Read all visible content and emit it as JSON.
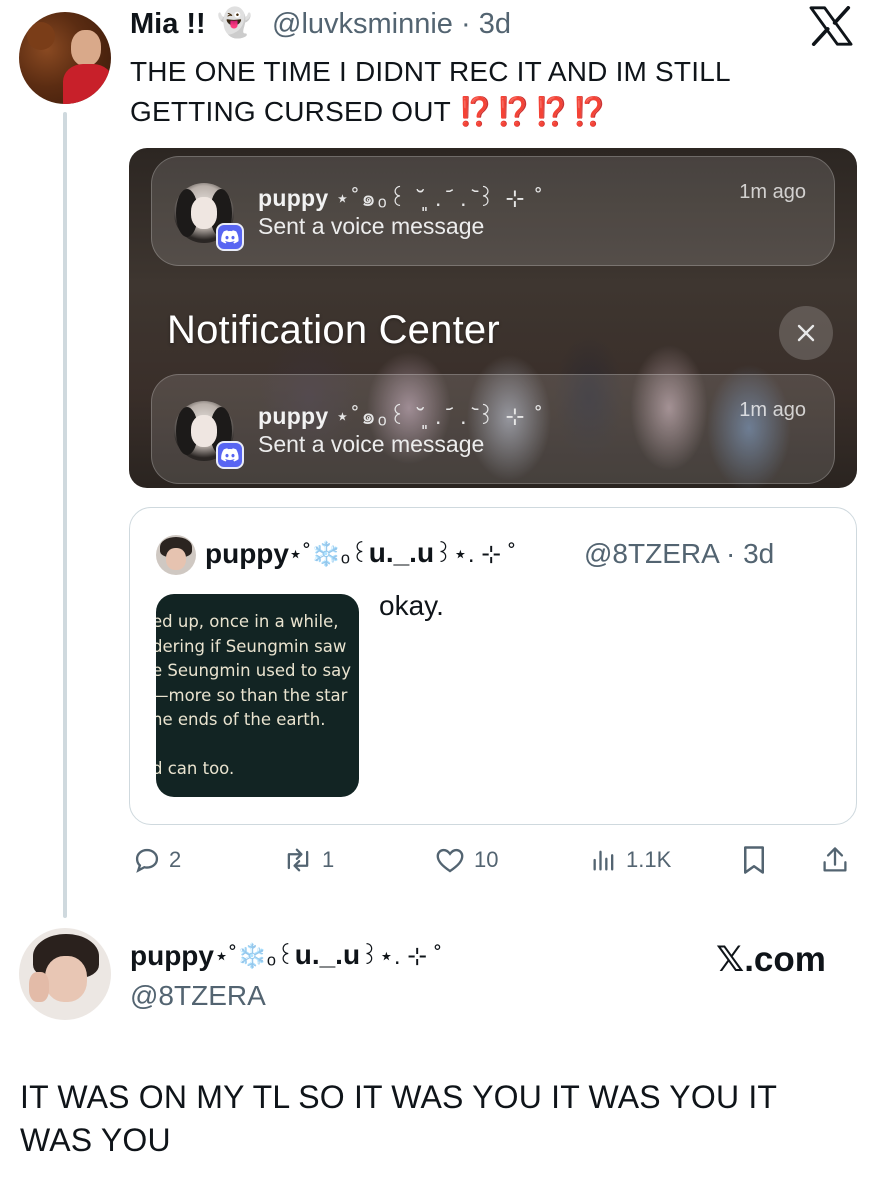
{
  "author": {
    "name": "Mia !!",
    "emoji": "👻",
    "handle_time": "@luvksminnie · 3d"
  },
  "tweet": {
    "text": "THE ONE TIME I DIDNT REC IT AND IM STILL GETTING CURSED OUT",
    "emphasis": "⁉️⁉️⁉️⁉️"
  },
  "notification_image": {
    "header": "Notification Center",
    "cards": [
      {
        "title": "puppy",
        "title_deco": "⋆˚๑ₒ꒰ ˘͈ . ᷄ . ᷅꒱ ⊹ ˚",
        "subtitle": "Sent a voice message",
        "time": "1m ago"
      },
      {
        "title": "puppy",
        "title_deco": "⋆˚๑ₒ꒰ ˘͈ . ᷄ . ᷅꒱ ⊹ ˚",
        "subtitle": "Sent a voice message",
        "time": "1m ago"
      }
    ]
  },
  "quote": {
    "name": "puppy",
    "name_deco": "⋆˚❄️ₒ꒰",
    "name_mid": "u._.u",
    "name_tail": "꒱⋆. ⊹ ˚",
    "handle_time": "@8TZERA · 3d",
    "text": "okay.",
    "thumb_text": "ed up, once in a while, \ndering if Seungmin saw\ne Seungmin used to say\n—more so than the star\nhe ends of the earth.\n\nd can too."
  },
  "actions": {
    "replies": "2",
    "reposts": "1",
    "likes": "10",
    "views": "1.1K"
  },
  "profile_card": {
    "name": "puppy",
    "name_deco": "⋆˚❄️ₒ꒰",
    "name_mid": "u._.u",
    "name_tail": "꒱⋆. ⊹ ˚",
    "handle": "@8TZERA",
    "site": "𝕏.com"
  },
  "bottom_text": "IT WAS ON MY TL SO IT WAS YOU IT WAS YOU IT WAS YOU",
  "colors": {
    "text": "#0f1419",
    "secondary": "#536471",
    "border": "#cfd9de",
    "emphasis": "#e2231a",
    "discord": "#5865f2"
  }
}
